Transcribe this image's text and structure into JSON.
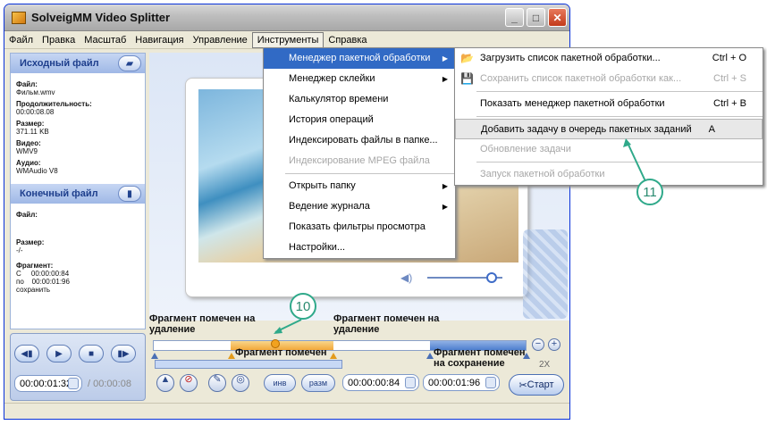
{
  "window": {
    "title": "SolveigMM Video Splitter",
    "controls": {
      "minimize": "_",
      "maximize": "□",
      "close": "✕"
    }
  },
  "menubar": [
    "Файл",
    "Правка",
    "Масштаб",
    "Навигация",
    "Управление",
    "Инструменты",
    "Справка"
  ],
  "source": {
    "title": "Исходный файл",
    "file_label": "Файл:",
    "file_value": "Фильм.wmv",
    "duration_label": "Продолжительность:",
    "duration_value": "00:00:08.08",
    "size_label": "Размер:",
    "size_value": "371.11 KB",
    "video_label": "Видео:",
    "video_value": "WMV9",
    "audio_label": "Аудио:",
    "audio_value": "WMAudio V8"
  },
  "target": {
    "title": "Конечный файл",
    "file_label": "Файл:",
    "size_label": "Размер:",
    "size_value": "-/-",
    "fragment_label": "Фрагмент:",
    "from_label": "С",
    "from_value": "00:00:00:84",
    "to_label": "по",
    "to_value": "00:00:01:96",
    "action_value": "сохранить"
  },
  "tools_menu": [
    {
      "label": "Менеджер пакетной обработки",
      "submenu": true,
      "state": "highlighted"
    },
    {
      "label": "Менеджер склейки",
      "submenu": true
    },
    {
      "label": "Калькулятор времени"
    },
    {
      "label": "История операций"
    },
    {
      "label": "Индексировать файлы в папке..."
    },
    {
      "label": "Индексирование MPEG файла",
      "state": "disabled"
    },
    {
      "label": "Открыть папку",
      "submenu": true
    },
    {
      "label": "Ведение журнала",
      "submenu": true
    },
    {
      "label": "Показать фильтры просмотра"
    },
    {
      "label": "Настройки..."
    }
  ],
  "batch_menu": [
    {
      "label": "Загрузить список пакетной обработки...",
      "shortcut": "Ctrl + O",
      "icon": "folder-icon"
    },
    {
      "label": "Сохранить список пакетной обработки как...",
      "shortcut": "Ctrl + S",
      "icon": "save-icon",
      "state": "disabled"
    },
    {
      "label": "Показать менеджер пакетной обработки",
      "shortcut": "Ctrl + B"
    },
    {
      "label": "Добавить задачу в очередь пакетных заданий",
      "shortcut": "A",
      "state": "hovered"
    },
    {
      "label": "Обновление задачи",
      "state": "disabled"
    },
    {
      "label": "Запуск пакетной обработки",
      "state": "disabled"
    }
  ],
  "timeline": {
    "fragment_del_1": "Фрагмент помечен на удаление",
    "fragment_del_2": "Фрагмент помечен на удаление",
    "fragment_keep_1": "Фрагмент помечен на сохранение",
    "fragment_keep_2": "Фрагмент помечен на сохранение",
    "zoom_label": "2X"
  },
  "playback": {
    "current_time": "00:00:01:32",
    "total_time": "/ 00:00:08",
    "marker_in": "00:00:00:84",
    "marker_out": "00:00:01:96",
    "invert_label": "инв",
    "split_label": "разм",
    "start_label": "Старт"
  },
  "callouts": {
    "c10": "10",
    "c11": "11"
  },
  "colors": {
    "accent_blue": "#316ac5",
    "callout_green": "#2fa98a",
    "keep_segment": "#f3a83a"
  }
}
